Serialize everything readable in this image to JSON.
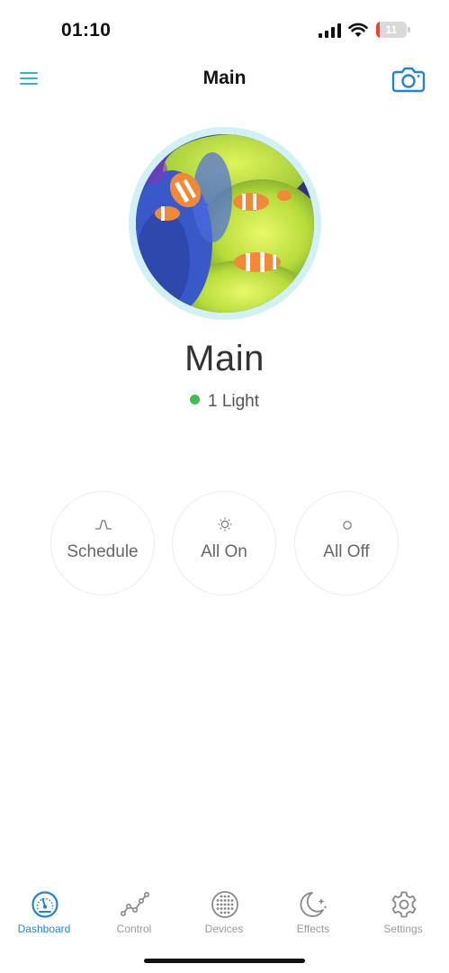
{
  "status_bar": {
    "time": "01:10",
    "battery_level": "11",
    "battery_color": "#e9423a",
    "icons": [
      "cellular-signal-icon",
      "wifi-icon",
      "battery-icon"
    ]
  },
  "header": {
    "title": "Main",
    "menu_icon": "hamburger-menu-icon",
    "camera_icon": "camera-icon"
  },
  "tank": {
    "name": "Main",
    "status_text": "1 Light",
    "status_color": "#3ebf4b",
    "photo": "aquarium-clownfish-photo"
  },
  "actions": [
    {
      "label": "Schedule",
      "icon": "schedule-wave-icon"
    },
    {
      "label": "All On",
      "icon": "sun-icon"
    },
    {
      "label": "All Off",
      "icon": "circle-off-icon"
    }
  ],
  "tabs": [
    {
      "label": "Dashboard",
      "icon": "dashboard-gauge-icon",
      "active": true
    },
    {
      "label": "Control",
      "icon": "control-graph-icon",
      "active": false
    },
    {
      "label": "Devices",
      "icon": "devices-grid-icon",
      "active": false
    },
    {
      "label": "Effects",
      "icon": "moon-stars-icon",
      "active": false
    },
    {
      "label": "Settings",
      "icon": "gear-icon",
      "active": false
    }
  ],
  "accent_color": "#1f84d6",
  "teal_color": "#2bb7c4"
}
